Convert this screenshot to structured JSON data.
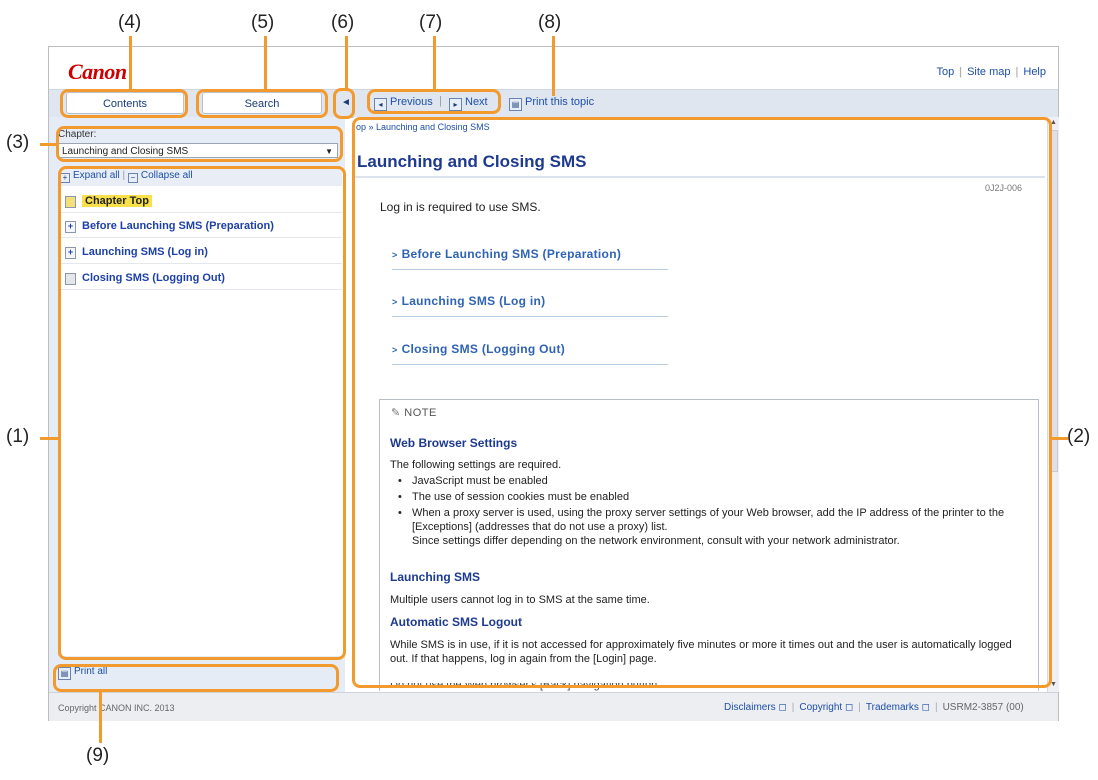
{
  "callouts": [
    "(1)",
    "(2)",
    "(3)",
    "(4)",
    "(5)",
    "(6)",
    "(7)",
    "(8)",
    "(9)"
  ],
  "header": {
    "logo": "Canon",
    "links": [
      "Top",
      "Site map",
      "Help"
    ]
  },
  "tabs": {
    "contents": "Contents",
    "search": "Search",
    "collapse_glyph": "◄"
  },
  "nav": {
    "previous": "Previous",
    "next": "Next",
    "print": "Print this topic"
  },
  "sidebar": {
    "chapter_label": "Chapter:",
    "chapter_value": "Launching and Closing SMS",
    "expand_all": "Expand all",
    "collapse_all": "Collapse all",
    "items": [
      {
        "label": "Chapter Top",
        "icon": "page-icon"
      },
      {
        "label": "Before Launching SMS (Preparation)",
        "icon": "expand-icon"
      },
      {
        "label": "Launching SMS (Log in)",
        "icon": "expand-icon"
      },
      {
        "label": "Closing SMS (Logging Out)",
        "icon": "page-icon"
      }
    ],
    "print_all": "Print all"
  },
  "main": {
    "breadcrumb": "op » Launching and Closing SMS",
    "title": "Launching and Closing SMS",
    "doc_id": "0J2J-006",
    "intro": "Log in is required to use SMS.",
    "links": [
      "Before Launching SMS (Preparation)",
      "Launching SMS (Log in)",
      "Closing SMS (Logging Out)"
    ],
    "note": {
      "header": "NOTE",
      "web_heading": "Web Browser Settings",
      "web_text": "The following settings are required.",
      "bullets": [
        "JavaScript must be enabled",
        "The use of session cookies must be enabled",
        "When a proxy server is used, using the proxy server settings of your Web browser, add the IP address of the printer to the [Exceptions] (addresses that do not use a proxy) list."
      ],
      "bullet3_extra": "Since settings differ depending on the network environment, consult with your network administrator.",
      "launch_heading": "Launching SMS",
      "launch_text": "Multiple users cannot log in to SMS at the same time.",
      "logout_heading": "Automatic SMS Logout",
      "logout_text": "While SMS is in use, if it is not accessed for approximately five minutes or more it times out and the user is automatically logged out. If that happens, log in again from the [Login] page.",
      "cut_text": "Do not use the Web browser's [Back] navigation button."
    }
  },
  "footer": {
    "copyright": "Copyright CANON INC. 2013",
    "links": [
      "Disclaimers",
      "Copyright",
      "Trademarks"
    ],
    "code": "USRM2-3857 (00)"
  }
}
